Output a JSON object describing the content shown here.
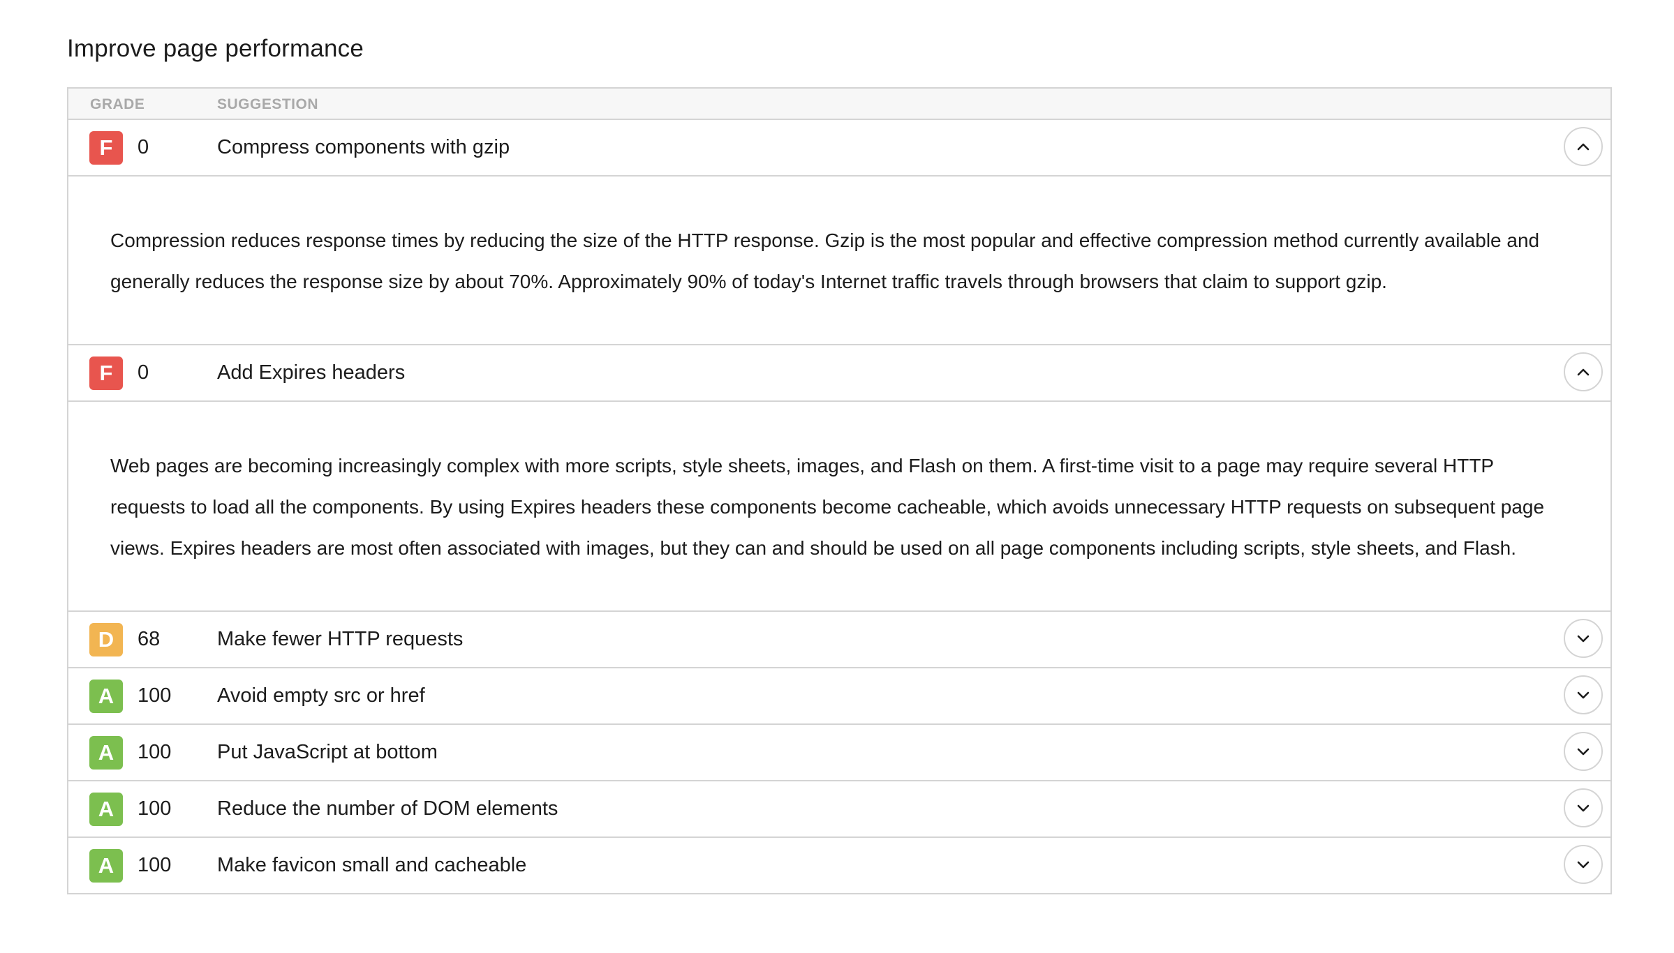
{
  "page": {
    "title": "Improve page performance"
  },
  "table": {
    "headers": {
      "grade": "GRADE",
      "suggestion": "SUGGESTION"
    },
    "rows": [
      {
        "grade": "F",
        "grade_color": "#e8554e",
        "score": "0",
        "suggestion": "Compress components with gzip",
        "expanded": true,
        "toggle_icon": "chevron-up-icon",
        "detail": "Compression reduces response times by reducing the size of the HTTP response. Gzip is the most popular and effective compression method currently available and generally reduces the response size by about 70%. Approximately 90% of today's Internet traffic travels through browsers that claim to support gzip."
      },
      {
        "grade": "F",
        "grade_color": "#e8554e",
        "score": "0",
        "suggestion": "Add Expires headers",
        "expanded": true,
        "toggle_icon": "chevron-up-icon",
        "detail": "Web pages are becoming increasingly complex with more scripts, style sheets, images, and Flash on them. A first-time visit to a page may require several HTTP requests to load all the components. By using Expires headers these components become cacheable, which avoids unnecessary HTTP requests on subsequent page views. Expires headers are most often associated with images, but they can and should be used on all page components including scripts, style sheets, and Flash."
      },
      {
        "grade": "D",
        "grade_color": "#f2b552",
        "score": "68",
        "suggestion": "Make fewer HTTP requests",
        "expanded": false,
        "toggle_icon": "chevron-down-icon"
      },
      {
        "grade": "A",
        "grade_color": "#7cbf4f",
        "score": "100",
        "suggestion": "Avoid empty src or href",
        "expanded": false,
        "toggle_icon": "chevron-down-icon"
      },
      {
        "grade": "A",
        "grade_color": "#7cbf4f",
        "score": "100",
        "suggestion": "Put JavaScript at bottom",
        "expanded": false,
        "toggle_icon": "chevron-down-icon"
      },
      {
        "grade": "A",
        "grade_color": "#7cbf4f",
        "score": "100",
        "suggestion": "Reduce the number of DOM elements",
        "expanded": false,
        "toggle_icon": "chevron-down-icon"
      },
      {
        "grade": "A",
        "grade_color": "#7cbf4f",
        "score": "100",
        "suggestion": "Make favicon small and cacheable",
        "expanded": false,
        "toggle_icon": "chevron-down-icon"
      }
    ]
  }
}
